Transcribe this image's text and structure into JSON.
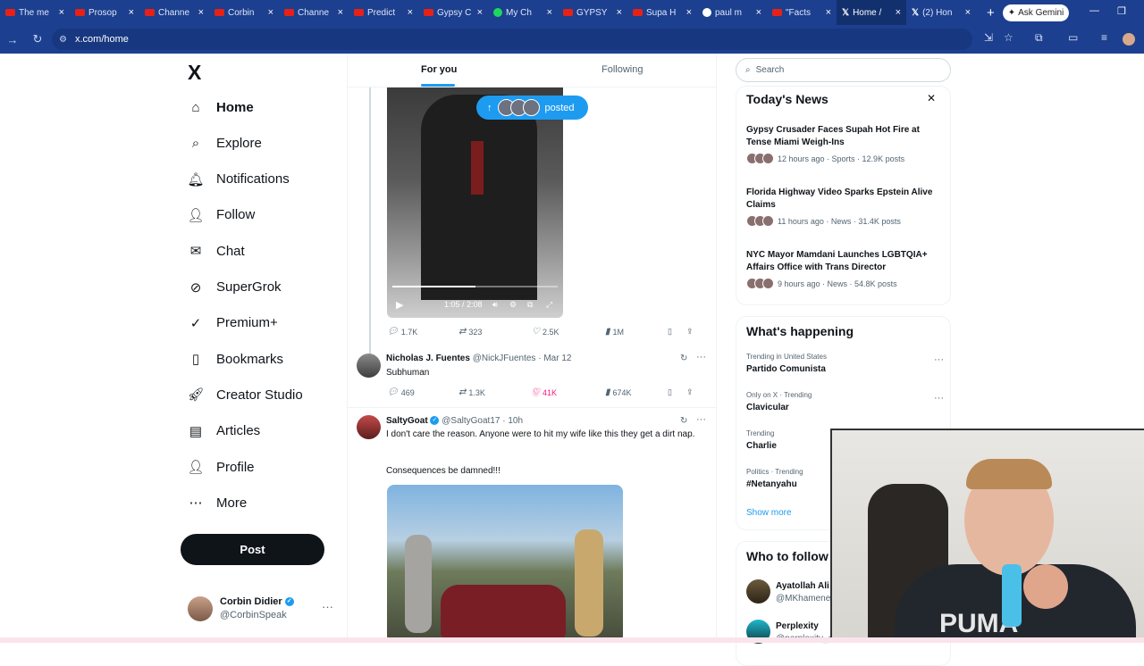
{
  "browser": {
    "tabs": [
      {
        "label": "The me",
        "favicon": "youtube"
      },
      {
        "label": "Prosop",
        "favicon": "youtube"
      },
      {
        "label": "Channe",
        "favicon": "youtube"
      },
      {
        "label": "Corbin",
        "favicon": "youtube"
      },
      {
        "label": "Channe",
        "favicon": "youtube"
      },
      {
        "label": "Predict",
        "favicon": "youtube"
      },
      {
        "label": "Gypsy C",
        "favicon": "youtube"
      },
      {
        "label": "My Ch",
        "favicon": "spotify"
      },
      {
        "label": "GYPSY",
        "favicon": "youtube"
      },
      {
        "label": "Supa H",
        "favicon": "youtube"
      },
      {
        "label": "paul m",
        "favicon": "google"
      },
      {
        "label": "\"Facts",
        "favicon": "youtube"
      },
      {
        "label": "Home /",
        "favicon": "x",
        "active": true
      },
      {
        "label": "(2) Hon",
        "favicon": "x"
      }
    ],
    "new_tab": "+",
    "gemini_label": "Ask Gemini",
    "url": "x.com/home"
  },
  "nav": {
    "logo": "X",
    "items": [
      {
        "label": "Home",
        "icon": "home-icon"
      },
      {
        "label": "Explore",
        "icon": "search-icon"
      },
      {
        "label": "Notifications",
        "icon": "bell-icon"
      },
      {
        "label": "Follow",
        "icon": "person-plus-icon"
      },
      {
        "label": "Chat",
        "icon": "mail-icon"
      },
      {
        "label": "SuperGrok",
        "icon": "grok-icon"
      },
      {
        "label": "Premium+",
        "icon": "verified-icon"
      },
      {
        "label": "Bookmarks",
        "icon": "bookmark-icon"
      },
      {
        "label": "Creator Studio",
        "icon": "rocket-icon"
      },
      {
        "label": "Articles",
        "icon": "article-icon"
      },
      {
        "label": "Profile",
        "icon": "person-icon"
      },
      {
        "label": "More",
        "icon": "more-circle-icon"
      }
    ],
    "post_label": "Post",
    "account": {
      "name": "Corbin Didier",
      "handle": "@CorbinSpeak"
    }
  },
  "feed": {
    "tabs": {
      "for_you": "For you",
      "following": "Following"
    },
    "posted_pill": "posted",
    "video1": {
      "time": "1:05 / 2:08",
      "progress": 0.5
    },
    "video1_actions": {
      "replies": "1.7K",
      "reposts": "323",
      "likes": "2.5K",
      "views": "1M"
    },
    "tweet1": {
      "name": "Nicholas J. Fuentes",
      "handle": "@NickJFuentes",
      "date": "· Mar 12",
      "text": "Subhuman",
      "actions": {
        "replies": "469",
        "reposts": "1.3K",
        "likes": "41K",
        "views": "674K"
      }
    },
    "tweet2": {
      "name": "SaltyGoat",
      "handle": "@SaltyGoat17",
      "date": "· 10h",
      "text1": "I don't care the reason.  Anyone were to hit my wife like this they get a dirt nap.",
      "text2": "Consequences be damned!!!"
    }
  },
  "right": {
    "search_placeholder": "Search",
    "today_news": {
      "title": "Today's News",
      "items": [
        {
          "headline": "Gypsy Crusader Faces Supah Hot Fire at Tense Miami Weigh-Ins",
          "meta": "12 hours ago · Sports · 12.9K posts"
        },
        {
          "headline": "Florida Highway Video Sparks Epstein Alive Claims",
          "meta": "11 hours ago · News · 31.4K posts"
        },
        {
          "headline": "NYC Mayor Mamdani Launches LGBTQIA+ Affairs Office with Trans Director",
          "meta": "9 hours ago · News · 54.8K posts"
        }
      ]
    },
    "whats_happening": {
      "title": "What's happening",
      "trends": [
        {
          "context": "Trending in United States",
          "name": "Partido Comunista"
        },
        {
          "context": "Only on X · Trending",
          "name": "Clavicular"
        },
        {
          "context": "Trending",
          "name": "Charlie"
        },
        {
          "context": "Politics · Trending",
          "name": "#Netanyahu"
        }
      ],
      "show_more": "Show more"
    },
    "who_to_follow": {
      "title": "Who to follow",
      "accounts": [
        {
          "name": "Ayatollah Ali Kh",
          "handle": "@MKhamenei"
        },
        {
          "name": "Perplexity",
          "handle": "@perplexity_ai"
        }
      ]
    }
  },
  "webcam": {
    "shirt_text": "PUMA"
  }
}
